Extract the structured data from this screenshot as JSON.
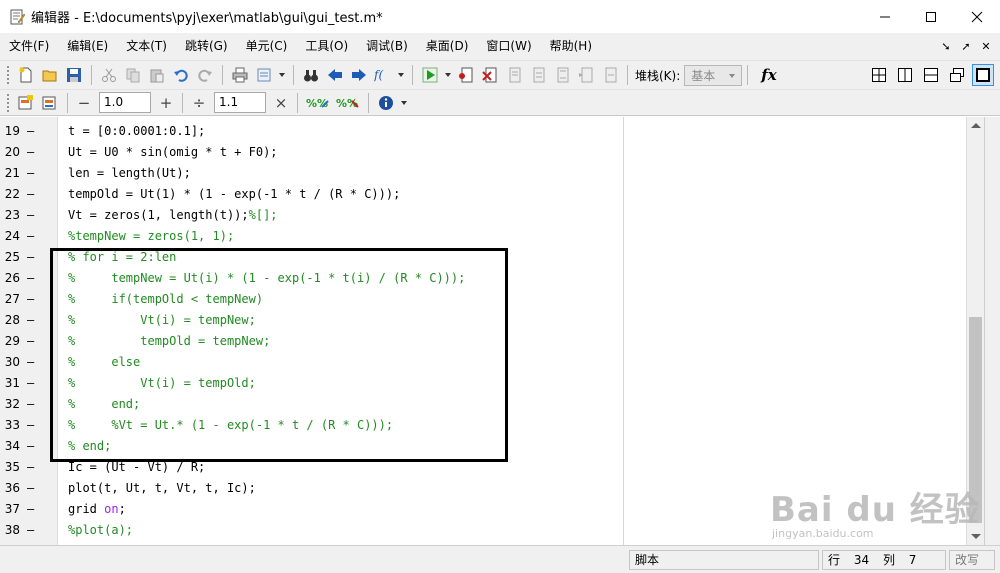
{
  "window": {
    "title": "编辑器 - E:\\documents\\pyj\\exer\\matlab\\gui\\gui_test.m*",
    "minimize": "—",
    "maximize": "☐",
    "close": "✕"
  },
  "menu": {
    "items": [
      {
        "label": "文件(F)"
      },
      {
        "label": "编辑(E)"
      },
      {
        "label": "文本(T)"
      },
      {
        "label": "跳转(G)"
      },
      {
        "label": "单元(C)"
      },
      {
        "label": "工具(O)"
      },
      {
        "label": "调试(B)"
      },
      {
        "label": "桌面(D)"
      },
      {
        "label": "窗口(W)"
      },
      {
        "label": "帮助(H)"
      }
    ]
  },
  "toolbar": {
    "stack_label": "堆栈(K):",
    "stack_value": "基本",
    "fx_label": "fx"
  },
  "cell_toolbar": {
    "decrement_value": "1.0",
    "divide_value": "1.1"
  },
  "code": {
    "lines": [
      {
        "num": "19",
        "text": "t = [0:0.0001:0.1];"
      },
      {
        "num": "20",
        "text": "Ut = U0 * sin(omig * t + F0);"
      },
      {
        "num": "21",
        "text": "len = length(Ut);"
      },
      {
        "num": "22",
        "text": "tempOld = Ut(1) * (1 - exp(-1 * t / (R * C)));"
      },
      {
        "num": "23",
        "text": "Vt = zeros(1, length(t));",
        "comment": "%[];"
      },
      {
        "num": "24",
        "comment": "%tempNew = zeros(1, 1);"
      },
      {
        "num": "25",
        "comment": "% for i = 2:len"
      },
      {
        "num": "26",
        "comment": "%     tempNew = Ut(i) * (1 - exp(-1 * t(i) / (R * C)));"
      },
      {
        "num": "27",
        "comment": "%     if(tempOld < tempNew)"
      },
      {
        "num": "28",
        "comment": "%         Vt(i) = tempNew;"
      },
      {
        "num": "29",
        "comment": "%         tempOld = tempNew;"
      },
      {
        "num": "30",
        "comment": "%     else"
      },
      {
        "num": "31",
        "comment": "%         Vt(i) = tempOld;"
      },
      {
        "num": "32",
        "comment": "%     end;"
      },
      {
        "num": "33",
        "comment": "%     %Vt = Ut.* (1 - exp(-1 * t / (R * C)));"
      },
      {
        "num": "34",
        "comment": "% end;"
      },
      {
        "num": "35",
        "text": "Ic = (Ut - Vt) / R;"
      },
      {
        "num": "36",
        "text": "plot(t, Ut, t, Vt, t, Ic);"
      },
      {
        "num": "37",
        "text": "grid ",
        "keyword": "on",
        "after": ";"
      },
      {
        "num": "38",
        "comment": "%plot(a);"
      }
    ],
    "dash": "–"
  },
  "status": {
    "script": "脚本",
    "row_label": "行",
    "row_value": "34",
    "col_label": "列",
    "col_value": "7",
    "mode": "改写"
  },
  "watermark": {
    "main": "Bai du 经验",
    "sub": "jingyan.baidu.com"
  }
}
